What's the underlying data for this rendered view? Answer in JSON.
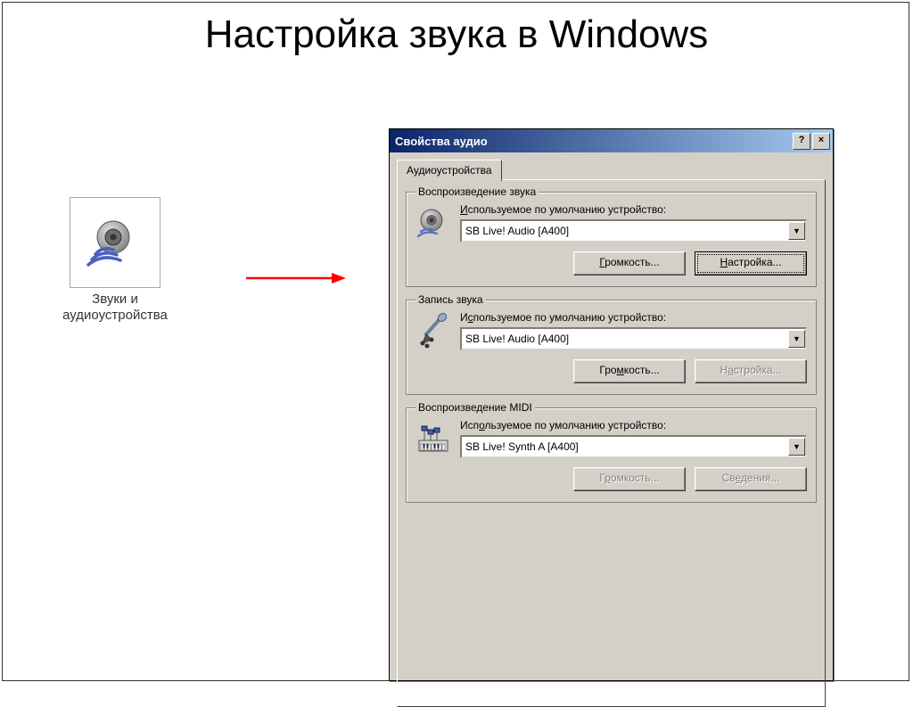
{
  "slide": {
    "title": "Настройка звука в Windows"
  },
  "shortcut": {
    "label1": "Звуки и",
    "label2": "аудиоустройства"
  },
  "dialog": {
    "title": "Свойства аудио",
    "help_btn": "?",
    "close_btn": "×",
    "tab": "Аудиоустройства",
    "groups": {
      "playback": {
        "legend": "Воспроизведение звука",
        "label": "Используемое по умолчанию устройство:",
        "device": "SB Live! Audio [A400]",
        "volume_btn": "Громкость...",
        "config_btn": "Настройка..."
      },
      "recording": {
        "legend": "Запись звука",
        "label": "Используемое по умолчанию устройство:",
        "device": "SB Live! Audio [A400]",
        "volume_btn": "Громкость...",
        "config_btn": "Настройка..."
      },
      "midi": {
        "legend": "Воспроизведение MIDI",
        "label": "Используемое по умолчанию устройство:",
        "device": "SB Live! Synth A [A400]",
        "volume_btn": "Громкость...",
        "info_btn": "Сведения..."
      }
    }
  }
}
